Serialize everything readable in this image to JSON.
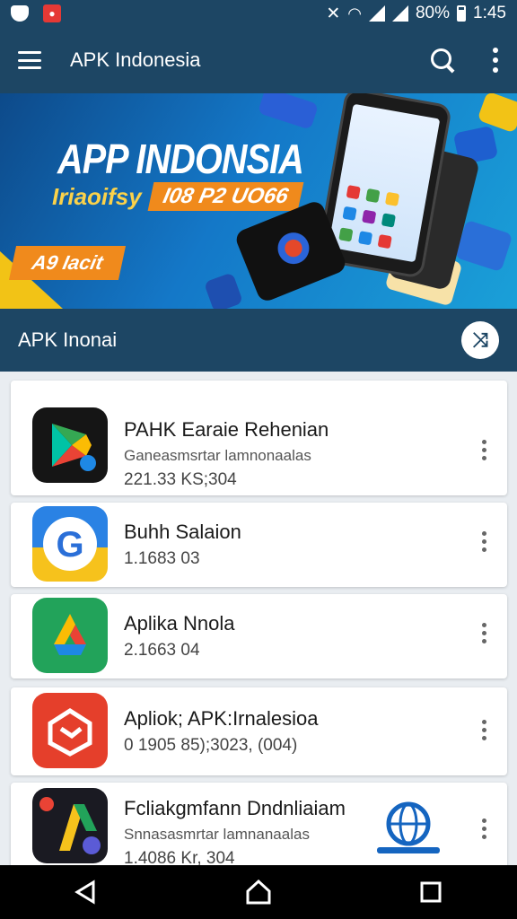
{
  "status_bar": {
    "battery": "80%",
    "time": "1:45",
    "icons": [
      "shield-icon",
      "app-notification-icon",
      "mute-icon",
      "wifi-icon",
      "signal-icon",
      "battery-icon"
    ]
  },
  "app_bar": {
    "title": "APK Indonesia",
    "icons": [
      "menu-icon",
      "search-icon",
      "more-vert-icon"
    ]
  },
  "banner": {
    "title": "APP INDONSIA",
    "subtitle_left": "Iriaoifsy",
    "subtitle_right": "I08 P2 UO66",
    "badge": "A9 Iacit",
    "colors": {
      "start": "#0d4a8a",
      "end": "#1aa0d8",
      "accent": "#f08a1c",
      "yellow": "#fbd24a"
    }
  },
  "section": {
    "title": "APK Inonai",
    "action_icon": "shuffle-icon"
  },
  "apps": [
    {
      "title": "PAHK Earaie Rehenian",
      "subtitle": "Ganeasmsrtar lamnonaalas",
      "meta": "221.33 KS;304",
      "icon": "play-store-icon"
    },
    {
      "title": "Buhh Salaion",
      "subtitle": "",
      "meta": "1.1683 03",
      "icon": "google-g-icon"
    },
    {
      "title": "Aplika Nnola",
      "subtitle": "",
      "meta": "2.1663 04",
      "icon": "drive-icon"
    },
    {
      "title": "Apliok; APK:Irnalesioa",
      "subtitle": "",
      "meta": "0 1905 85);3023, (004)",
      "icon": "red-box-icon"
    },
    {
      "title": "Fcliakgmfann Dndnliaiam",
      "subtitle": "Snnasasmrtar lamnanaalas",
      "meta": "1.4086 Kr, 304",
      "icon": "dark-app-icon"
    }
  ],
  "colors": {
    "primary": "#1d4664",
    "background": "#e9edf1",
    "nav": "#000000"
  },
  "nav_bar": {
    "icons": [
      "back-icon",
      "home-icon",
      "recents-icon"
    ]
  }
}
